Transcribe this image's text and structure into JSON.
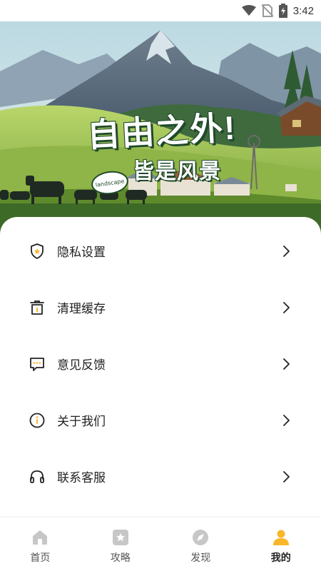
{
  "status_bar": {
    "time": "3:42"
  },
  "hero": {
    "headline_line1": "自由之外!",
    "headline_line2": "皆是风景",
    "tag": "landscape"
  },
  "menu": [
    {
      "label": "隐私设置",
      "icon": "shield-icon"
    },
    {
      "label": "清理缓存",
      "icon": "trash-icon"
    },
    {
      "label": "意见反馈",
      "icon": "feedback-icon"
    },
    {
      "label": "关于我们",
      "icon": "info-icon"
    },
    {
      "label": "联系客服",
      "icon": "headset-icon"
    }
  ],
  "bottom_nav": [
    {
      "label": "首页",
      "icon": "home-icon"
    },
    {
      "label": "攻略",
      "icon": "star-box-icon"
    },
    {
      "label": "发现",
      "icon": "compass-icon"
    },
    {
      "label": "我的",
      "icon": "user-icon",
      "active": true
    }
  ],
  "colors": {
    "accent": "#f9b72a",
    "icon_inactive": "#c7c7c7"
  }
}
